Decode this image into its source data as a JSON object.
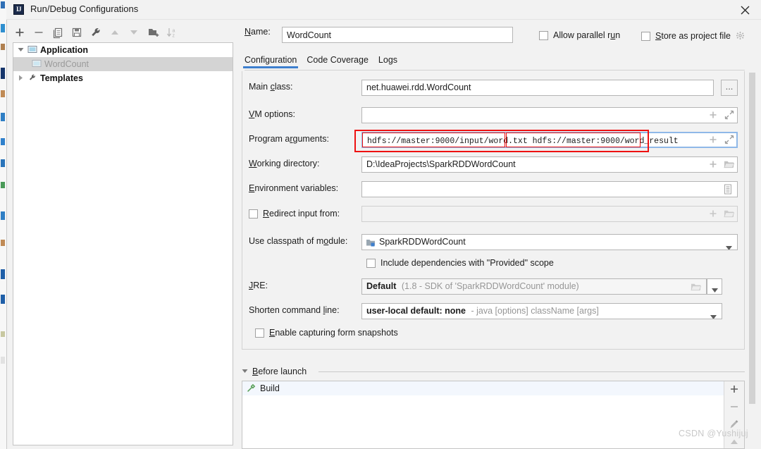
{
  "window": {
    "title": "Run/Debug Configurations",
    "app_icon": "intellij-idea-icon",
    "close_label": "×"
  },
  "tree_toolbar": {
    "buttons": [
      {
        "name": "add-configuration-button",
        "icon": "plus-icon"
      },
      {
        "name": "remove-configuration-button",
        "icon": "minus-icon"
      },
      {
        "name": "copy-configuration-button",
        "icon": "copy-icon"
      },
      {
        "name": "save-configuration-button",
        "icon": "save-icon"
      },
      {
        "name": "edit-templates-button",
        "icon": "wrench-icon"
      },
      {
        "name": "move-up-button",
        "icon": "arrow-up-icon"
      },
      {
        "name": "move-down-button",
        "icon": "arrow-down-icon"
      },
      {
        "name": "create-folder-button",
        "icon": "folder-add-icon"
      },
      {
        "name": "sort-configurations-button",
        "icon": "sort-az-icon"
      }
    ]
  },
  "tree": {
    "nodes": [
      {
        "label": "Application",
        "icon": "application-icon",
        "expanded": true,
        "selected": false
      },
      {
        "label": "WordCount",
        "icon": "application-icon",
        "child": true,
        "selected": true
      },
      {
        "label": "Templates",
        "icon": "wrench-icon",
        "expanded": false,
        "selected": false
      }
    ]
  },
  "header": {
    "name_label": "Name:",
    "name_value": "WordCount",
    "allow_parallel_run": {
      "label": "Allow parallel run",
      "checked": false
    },
    "store_as_project_file": {
      "label": "Store as project file",
      "checked": false,
      "gear_icon": "gear-icon"
    }
  },
  "tabs": [
    {
      "label": "Configuration",
      "active": true
    },
    {
      "label": "Code Coverage",
      "active": false
    },
    {
      "label": "Logs",
      "active": false
    }
  ],
  "form": {
    "main_class": {
      "label_pre": "Main ",
      "label_mnemonic": "c",
      "label_post": "lass:",
      "value": "net.huawei.rdd.WordCount",
      "browse_label": "..."
    },
    "vm_options": {
      "label_pre": "",
      "label_mnemonic": "V",
      "label_post": "M options:",
      "value": "",
      "macro_icon": "plus-icon",
      "expand_icon": "expand-icon"
    },
    "program_arguments": {
      "label_pre": "Program a",
      "label_mnemonic": "r",
      "label_post": "guments:",
      "value": "hdfs://master:9000/input/word.txt hdfs://master:9000/word_result",
      "arg1": "hdfs://master:9000/input/word.txt",
      "arg2": "hdfs://master:9000/word_result",
      "macro_icon": "plus-icon",
      "expand_icon": "expand-icon",
      "focused": true
    },
    "working_directory": {
      "label_pre": "",
      "label_mnemonic": "W",
      "label_post": "orking directory:",
      "value": "D:\\IdeaProjects\\SparkRDDWordCount",
      "macro_icon": "plus-icon",
      "browse_icon": "folder-icon"
    },
    "environment_variables": {
      "label_pre": "",
      "label_mnemonic": "E",
      "label_post": "nvironment variables:",
      "value": "",
      "browse_icon": "list-icon"
    },
    "redirect_input_from": {
      "label_pre": "",
      "label_mnemonic": "R",
      "label_post": "edirect input from:",
      "checked": false,
      "value": "",
      "macro_icon": "plus-icon",
      "browse_icon": "folder-icon"
    },
    "use_classpath_of_module": {
      "label_pre": "Use classpath of m",
      "label_mnemonic": "o",
      "label_post": "dule:",
      "value": "SparkRDDWordCount",
      "icon": "module-icon",
      "dropdown_icon": "chevron-down-icon"
    },
    "include_provided_scope": {
      "label": "Include dependencies with \"Provided\" scope",
      "checked": false
    },
    "jre": {
      "label_pre": "",
      "label_mnemonic": "J",
      "label_post": "RE:",
      "value": "Default",
      "hint": "(1.8 - SDK of 'SparkRDDWordCount' module)",
      "browse_icon": "folder-icon",
      "dropdown_icon": "chevron-down-icon"
    },
    "shorten_command_line": {
      "label_pre": "Shorten command ",
      "label_mnemonic": "l",
      "label_post": "ine:",
      "value": "user-local default: none",
      "hint": "- java [options] className [args]",
      "dropdown_icon": "chevron-down-icon"
    },
    "enable_capturing_form_snapshots": {
      "label_pre": "",
      "label_mnemonic": "E",
      "label_post": "nable capturing form snapshots",
      "checked": false
    }
  },
  "before_launch": {
    "section_label_pre": "",
    "section_label_mnemonic": "B",
    "section_label_post": "efore launch",
    "expanded": true,
    "items": [
      {
        "label": "Build",
        "icon": "build-hammer-icon"
      }
    ],
    "side_buttons": [
      {
        "name": "add-before-launch-task-button",
        "icon": "plus-icon"
      },
      {
        "name": "remove-before-launch-task-button",
        "icon": "minus-icon"
      },
      {
        "name": "edit-before-launch-task-button",
        "icon": "pencil-icon"
      },
      {
        "name": "move-before-launch-task-up-button",
        "icon": "arrow-up-icon"
      }
    ]
  },
  "watermark": {
    "text": "CSDN @Yushijuj"
  },
  "colors": {
    "accent_blue": "#3d7fce",
    "focus_border": "#8fb8e8",
    "annotation_red": "#ee1111",
    "panel_bg": "#f2f2f2",
    "field_bg": "#ffffff",
    "selection_gray": "#d4d4d4",
    "muted_text": "#969696",
    "watermark_gray": "#c9c9c9"
  }
}
